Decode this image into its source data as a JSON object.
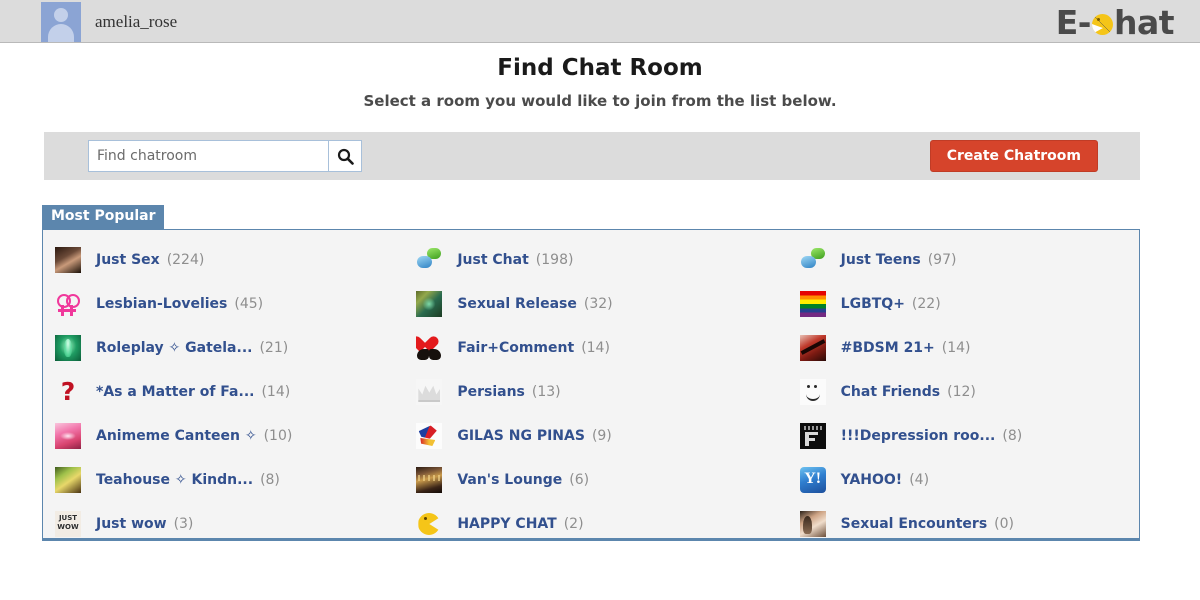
{
  "topbar": {
    "username": "amelia_rose",
    "avatar_icon": "user-avatar-icon",
    "logo_prefix": "E-",
    "logo_suffix": "hat",
    "logo_icon": "pacman-icon"
  },
  "header": {
    "title": "Find Chat Room",
    "subtitle": "Select a room you would like to join from the list below."
  },
  "search": {
    "placeholder": "Find chatroom",
    "value": "",
    "button_icon": "search-icon",
    "create_label": "Create Chatroom"
  },
  "panel": {
    "tab_label": "Most Popular",
    "accent_color": "#5c86ad",
    "link_color": "#32508e",
    "count_color": "#8e8e8e",
    "create_button_color": "#d6442b",
    "columns": [
      {
        "rooms": [
          {
            "name": "Just Sex",
            "count": "(224)",
            "icon": "photo-dark-icon"
          },
          {
            "name": "Lesbian-Lovelies",
            "count": "(45)",
            "icon": "double-venus-icon"
          },
          {
            "name": "Roleplay ✧ Gatela...",
            "count": "(21)",
            "icon": "green-figure-icon"
          },
          {
            "name": "*As a Matter of Fa...",
            "count": "(14)",
            "icon": "question-mark-icon"
          },
          {
            "name": "Animeme Canteen ✧",
            "count": "(10)",
            "icon": "anime-girl-icon"
          },
          {
            "name": "Teahouse ✧ Kindn...",
            "count": "(8)",
            "icon": "teahouse-icon"
          },
          {
            "name": "Just wow",
            "count": "(3)",
            "icon": "just-wow-icon"
          }
        ]
      },
      {
        "rooms": [
          {
            "name": "Just Chat",
            "count": "(198)",
            "icon": "chat-bubbles-icon"
          },
          {
            "name": "Sexual Release",
            "count": "(32)",
            "icon": "forest-photo-icon"
          },
          {
            "name": "Fair+Comment",
            "count": "(14)",
            "icon": "heart-in-hands-icon"
          },
          {
            "name": "Persians",
            "count": "(13)",
            "icon": "crown-icon"
          },
          {
            "name": "GILAS NG PINAS",
            "count": "(9)",
            "icon": "eagle-flag-icon"
          },
          {
            "name": "Van's Lounge",
            "count": "(6)",
            "icon": "lounge-photo-icon"
          },
          {
            "name": "HAPPY CHAT",
            "count": "(2)",
            "icon": "pacman-icon"
          }
        ]
      },
      {
        "rooms": [
          {
            "name": "Just Teens",
            "count": "(97)",
            "icon": "chat-bubbles-icon"
          },
          {
            "name": "LGBTQ+",
            "count": "(22)",
            "icon": "rainbow-flag-icon"
          },
          {
            "name": "#BDSM 21+",
            "count": "(14)",
            "icon": "bdsm-photo-icon"
          },
          {
            "name": "Chat Friends",
            "count": "(12)",
            "icon": "smiley-face-icon"
          },
          {
            "name": "!!!Depression roo...",
            "count": "(8)",
            "icon": "depression-icon"
          },
          {
            "name": "YAHOO!",
            "count": "(4)",
            "icon": "yahoo-icon"
          },
          {
            "name": "Sexual Encounters",
            "count": "(0)",
            "icon": "couple-photo-icon"
          }
        ]
      }
    ]
  }
}
